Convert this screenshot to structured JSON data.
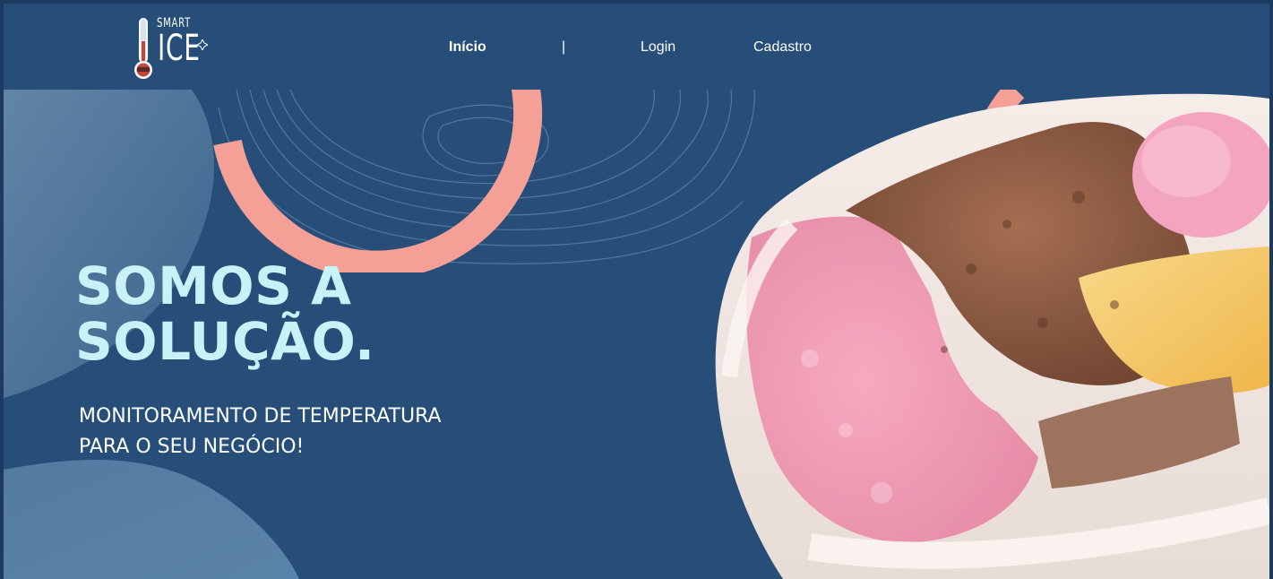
{
  "brand": {
    "logo_line1": "SMART",
    "logo_line2": "ICE",
    "logo_icon": "thermometer-icon"
  },
  "nav": {
    "items": [
      {
        "label": "Início",
        "active": true
      },
      {
        "separator": "|"
      },
      {
        "label": "Login",
        "active": false
      },
      {
        "label": "Cadastro",
        "active": false
      }
    ]
  },
  "hero": {
    "title_line1": "SOMOS A",
    "title_line2": "SOLUÇÃO.",
    "subtitle_line1": "MONITORAMENTO DE TEMPERATURA",
    "subtitle_line2": "PARA O SEU NEGÓCIO!",
    "image_subject": "ice-cream-tub-image"
  },
  "colors": {
    "background": "#264e78",
    "outer_border": "#1f3a60",
    "accent_coral": "#f4a097",
    "title_color": "#c9f2f8",
    "text_color": "#ffffff"
  }
}
